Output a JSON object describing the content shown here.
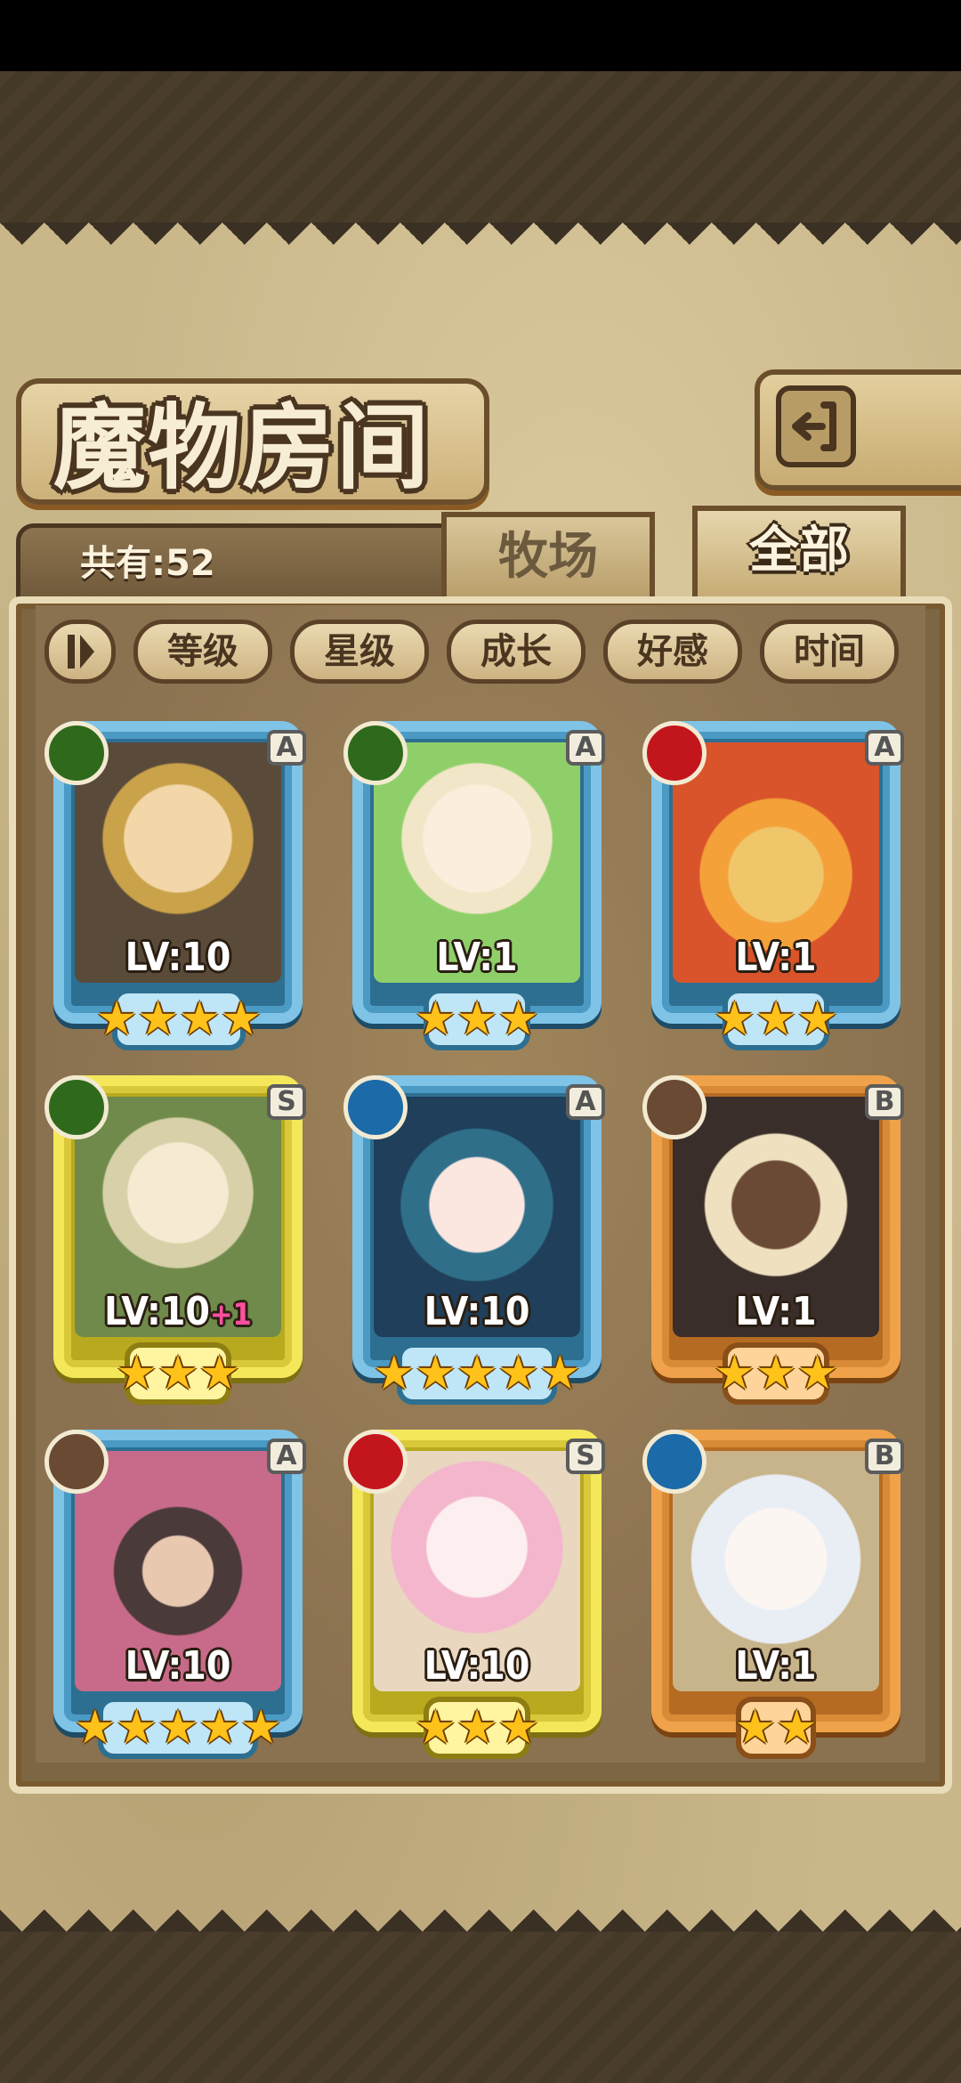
{
  "header": {
    "title": "魔物房间",
    "back_label": ""
  },
  "count_label": "共有:52",
  "tabs": [
    {
      "label": "牧场",
      "active": false
    },
    {
      "label": "全部",
      "active": true
    }
  ],
  "sort_buttons": [
    "等级",
    "星级",
    "成长",
    "好感",
    "时间"
  ],
  "monsters": [
    {
      "element": "leaf-icon",
      "rank": "A",
      "level": "LV:10",
      "bonus": "",
      "stars": 4
    },
    {
      "element": "leaf-icon",
      "rank": "A",
      "level": "LV:1",
      "bonus": "",
      "stars": 3
    },
    {
      "element": "fire-icon",
      "rank": "A",
      "level": "LV:1",
      "bonus": "",
      "stars": 3
    },
    {
      "element": "leaf-icon",
      "rank": "S",
      "level": "LV:10",
      "bonus": "+1",
      "stars": 3
    },
    {
      "element": "water-icon",
      "rank": "A",
      "level": "LV:10",
      "bonus": "",
      "stars": 5
    },
    {
      "element": "earth-icon",
      "rank": "B",
      "level": "LV:1",
      "bonus": "",
      "stars": 3
    },
    {
      "element": "earth-icon",
      "rank": "A",
      "level": "LV:10",
      "bonus": "",
      "stars": 5
    },
    {
      "element": "fire-icon",
      "rank": "S",
      "level": "LV:10",
      "bonus": "",
      "stars": 3
    },
    {
      "element": "water-icon",
      "rank": "B",
      "level": "LV:1",
      "bonus": "",
      "stars": 2
    }
  ],
  "colors": {
    "rank_a_frame": "#7fc3e6",
    "rank_s_frame": "#f4e85a",
    "rank_b_frame": "#f0a24a",
    "star": "#ffc21a",
    "bonus": "#ff4fa0"
  }
}
